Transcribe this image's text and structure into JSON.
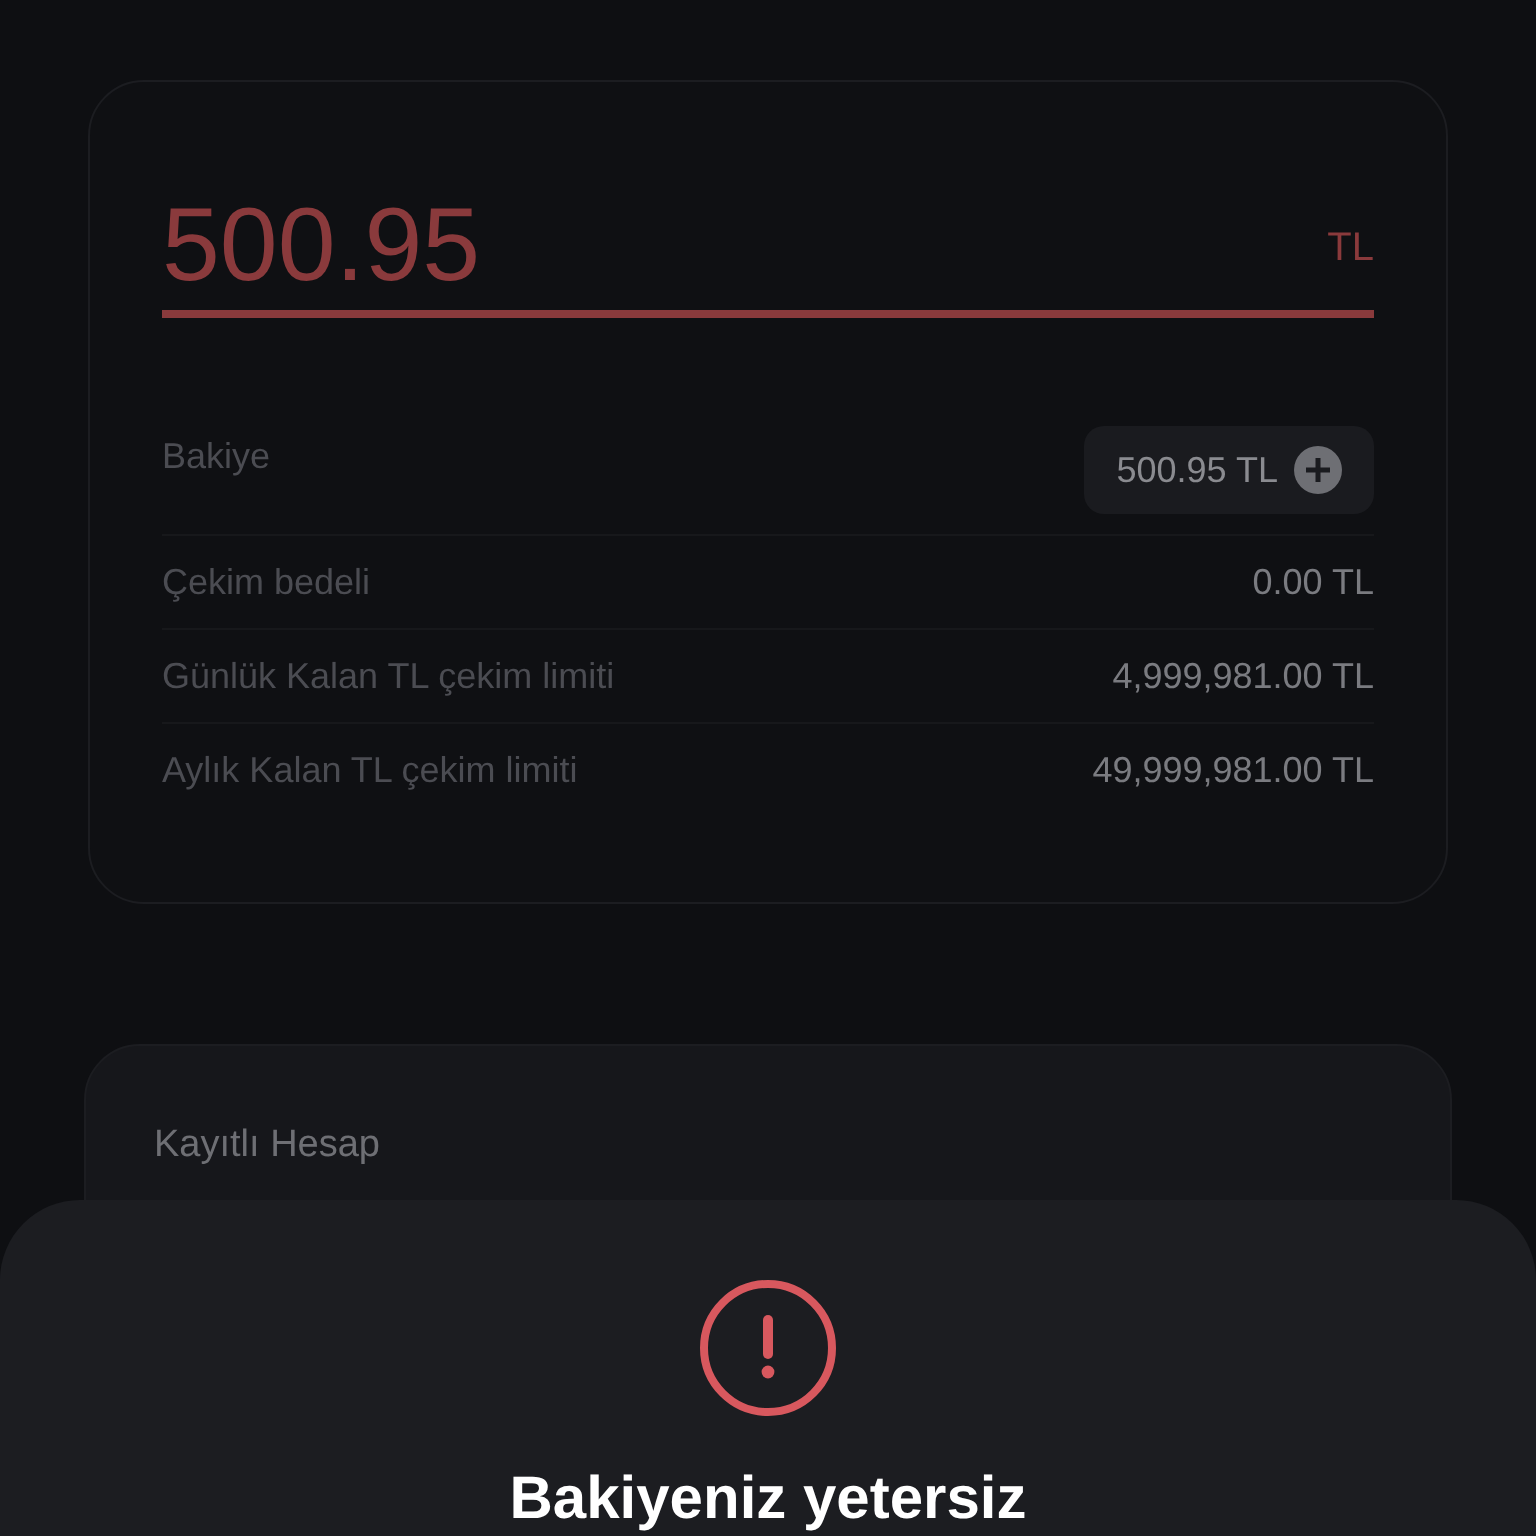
{
  "amount_field": {
    "value": "500.95",
    "currency": "TL",
    "error": true
  },
  "details": [
    {
      "label": "Bakiye",
      "value": "500.95 TL",
      "kind": "balance"
    },
    {
      "label": "Çekim bedeli",
      "value": "0.00 TL",
      "kind": "plain"
    },
    {
      "label": "Günlük Kalan TL çekim limiti",
      "value": "4,999,981.00 TL",
      "kind": "plain"
    },
    {
      "label": "Aylık Kalan TL çekim limiti",
      "value": "49,999,981.00 TL",
      "kind": "plain"
    }
  ],
  "saved_account": {
    "label": "Kayıtlı Hesap"
  },
  "alert_sheet": {
    "title": "Bakiyeniz yetersiz"
  }
}
